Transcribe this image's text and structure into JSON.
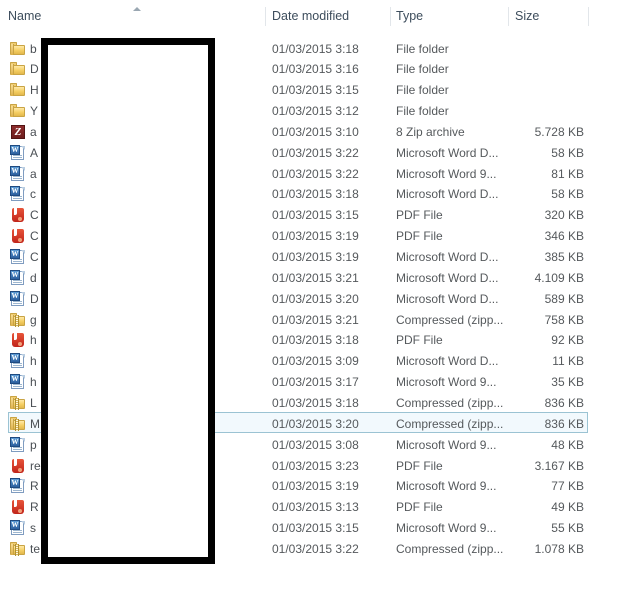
{
  "window": {
    "view": "details-list",
    "sort_column": "Name",
    "sort_direction": "ascending"
  },
  "colors": {
    "header_text": "#3d4d5c",
    "row_text": "#55595c",
    "selection_border": "#9bc3d3",
    "selection_fill": "#f2f9fd",
    "redaction": "#000000",
    "folder_yellow": "#f5ce63",
    "word_blue": "#2c5f9e",
    "pdf_red": "#c0241a",
    "sevenzip_maroon": "#8e2d2d"
  },
  "columns": [
    {
      "key": "name",
      "label": "Name",
      "sorted": true
    },
    {
      "key": "date",
      "label": "Date modified",
      "sorted": false
    },
    {
      "key": "type",
      "label": "Type",
      "sorted": false
    },
    {
      "key": "size",
      "label": "Size",
      "sorted": false
    }
  ],
  "icons": {
    "sort_ascending": "caret-up-icon",
    "folder": "folder-icon",
    "zip": "compressed-folder-icon",
    "word": "word-document-icon",
    "pdf": "pdf-file-icon",
    "sevenzip": "7zip-archive-icon"
  },
  "rows": [
    {
      "icon": "folder",
      "name": "b",
      "date": "01/03/2015 3:18",
      "type": "File folder",
      "size": "",
      "selected": false
    },
    {
      "icon": "folder",
      "name": "D",
      "date": "01/03/2015 3:16",
      "type": "File folder",
      "size": "",
      "selected": false
    },
    {
      "icon": "folder",
      "name": "H",
      "date": "01/03/2015 3:15",
      "type": "File folder",
      "size": "",
      "selected": false
    },
    {
      "icon": "folder",
      "name": "Y",
      "date": "01/03/2015 3:12",
      "type": "File folder",
      "size": "",
      "selected": false
    },
    {
      "icon": "sevenzip",
      "name": "a",
      "date": "01/03/2015 3:10",
      "type": "8 Zip archive",
      "size": "5.728 KB",
      "selected": false
    },
    {
      "icon": "word",
      "name": "A",
      "date": "01/03/2015 3:22",
      "type": "Microsoft Word D...",
      "size": "58 KB",
      "selected": false
    },
    {
      "icon": "word",
      "name": "a",
      "date": "01/03/2015 3:22",
      "type": "Microsoft Word 9...",
      "size": "81 KB",
      "selected": false
    },
    {
      "icon": "word",
      "name": "c",
      "date": "01/03/2015 3:18",
      "type": "Microsoft Word D...",
      "size": "58 KB",
      "selected": false
    },
    {
      "icon": "pdf",
      "name": "C",
      "date": "01/03/2015 3:15",
      "type": "PDF File",
      "size": "320 KB",
      "selected": false
    },
    {
      "icon": "pdf",
      "name": "C",
      "date": "01/03/2015 3:19",
      "type": "PDF File",
      "size": "346 KB",
      "selected": false
    },
    {
      "icon": "word",
      "name": "C",
      "date": "01/03/2015 3:19",
      "type": "Microsoft Word D...",
      "size": "385 KB",
      "selected": false
    },
    {
      "icon": "word",
      "name": "d",
      "date": "01/03/2015 3:21",
      "type": "Microsoft Word D...",
      "size": "4.109 KB",
      "selected": false
    },
    {
      "icon": "word",
      "name": "D",
      "date": "01/03/2015 3:20",
      "type": "Microsoft Word D...",
      "size": "589 KB",
      "selected": false
    },
    {
      "icon": "zip",
      "name": "g",
      "date": "01/03/2015 3:21",
      "type": "Compressed (zipp...",
      "size": "758 KB",
      "selected": false
    },
    {
      "icon": "pdf",
      "name": "h",
      "date": "01/03/2015 3:18",
      "type": "PDF File",
      "size": "92 KB",
      "selected": false
    },
    {
      "icon": "word",
      "name": "h",
      "date": "01/03/2015 3:09",
      "type": "Microsoft Word D...",
      "size": "11 KB",
      "selected": false
    },
    {
      "icon": "word",
      "name": "h",
      "date": "01/03/2015 3:17",
      "type": "Microsoft Word 9...",
      "size": "35 KB",
      "selected": false
    },
    {
      "icon": "zip",
      "name": "L",
      "date": "01/03/2015 3:18",
      "type": "Compressed (zipp...",
      "size": "836 KB",
      "selected": false
    },
    {
      "icon": "zip",
      "name": "M",
      "date": "01/03/2015 3:20",
      "type": "Compressed (zipp...",
      "size": "836 KB",
      "selected": true
    },
    {
      "icon": "word",
      "name": "p",
      "date": "01/03/2015 3:08",
      "type": "Microsoft Word 9...",
      "size": "48 KB",
      "selected": false
    },
    {
      "icon": "pdf",
      "name": "re",
      "date": "01/03/2015 3:23",
      "type": "PDF File",
      "size": "3.167 KB",
      "selected": false
    },
    {
      "icon": "word",
      "name": "R",
      "date": "01/03/2015 3:19",
      "type": "Microsoft Word 9...",
      "size": "77 KB",
      "selected": false
    },
    {
      "icon": "pdf",
      "name": "R",
      "date": "01/03/2015 3:13",
      "type": "PDF File",
      "size": "49 KB",
      "selected": false
    },
    {
      "icon": "word",
      "name": "s",
      "date": "01/03/2015 3:15",
      "type": "Microsoft Word 9...",
      "size": "55 KB",
      "selected": false
    },
    {
      "icon": "zip",
      "name": "te",
      "date": "01/03/2015 3:22",
      "type": "Compressed (zipp...",
      "size": "1.078 KB",
      "selected": false
    }
  ],
  "redaction_overlay": {
    "present": true,
    "covers": "name-column",
    "label": ""
  }
}
